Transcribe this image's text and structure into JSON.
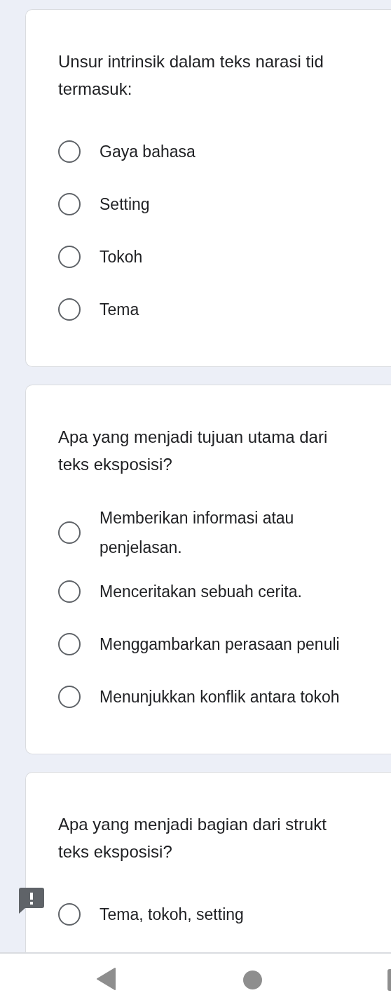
{
  "questions": [
    {
      "lines": [
        "Unsur intrinsik dalam teks narasi tid",
        "termasuk:"
      ],
      "flagged": false,
      "options": [
        {
          "lines": [
            "Gaya bahasa"
          ],
          "selected": false
        },
        {
          "lines": [
            "Setting"
          ],
          "selected": false
        },
        {
          "lines": [
            "Tokoh"
          ],
          "selected": false
        },
        {
          "lines": [
            "Tema"
          ],
          "selected": false
        }
      ]
    },
    {
      "lines": [
        "Apa yang menjadi tujuan utama dari",
        "teks eksposisi?"
      ],
      "flagged": false,
      "options": [
        {
          "lines": [
            "Memberikan informasi atau",
            "penjelasan."
          ],
          "selected": false
        },
        {
          "lines": [
            "Menceritakan sebuah cerita."
          ],
          "selected": false
        },
        {
          "lines": [
            "Menggambarkan perasaan penuli"
          ],
          "selected": false
        },
        {
          "lines": [
            "Menunjukkan konflik antara tokoh"
          ],
          "selected": false
        }
      ]
    },
    {
      "lines": [
        "Apa yang menjadi bagian dari strukt",
        "teks eksposisi?"
      ],
      "flagged": true,
      "options": [
        {
          "lines": [
            "Tema, tokoh, setting"
          ],
          "selected": false
        }
      ]
    }
  ]
}
